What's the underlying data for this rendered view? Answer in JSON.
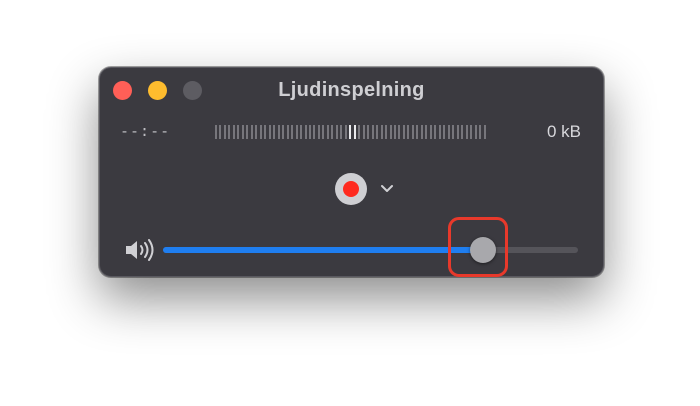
{
  "window": {
    "title": "Ljudinspelning"
  },
  "status": {
    "time": "--:--",
    "file_size": "0 kB"
  },
  "controls": {
    "record_icon": "record-icon",
    "options_icon": "chevron-down-icon",
    "volume_icon": "speaker-volume-icon",
    "volume_level": 0.77
  },
  "colors": {
    "close": "#ff5f57",
    "minimize": "#febc2e",
    "zoom_disabled": "#5d5c62",
    "record": "#ff2a1f",
    "accent": "#1f7ef0",
    "highlight": "#e8392b"
  }
}
